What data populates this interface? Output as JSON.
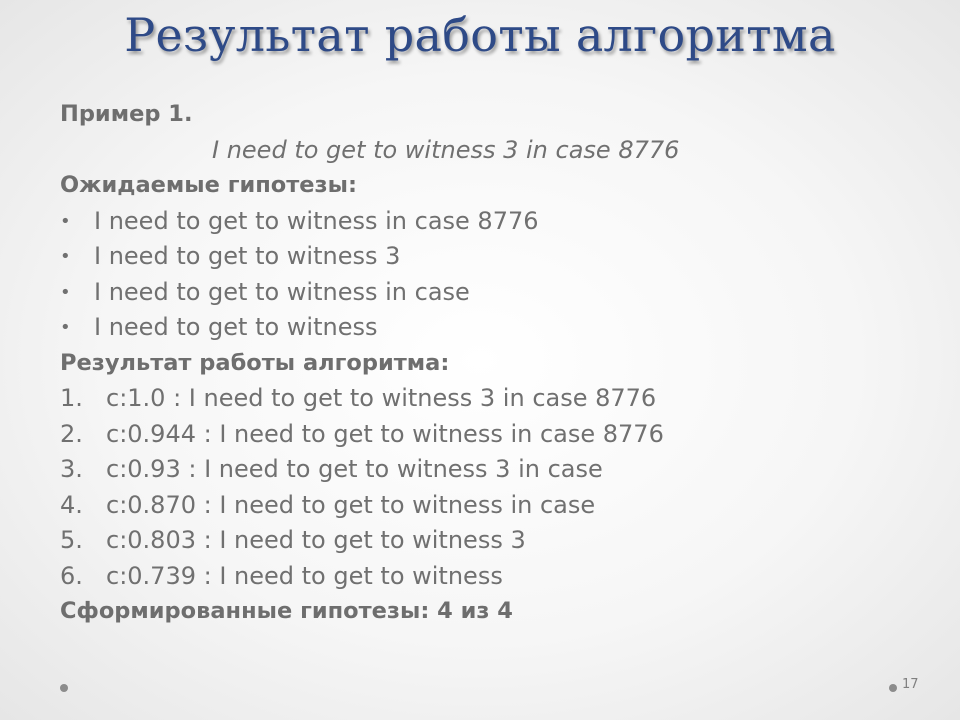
{
  "slide": {
    "title": "Результат работы алгоритма",
    "example_heading": "Пример 1.",
    "example_text": "I need to get to witness 3 in case 8776",
    "expected_heading": "Ожидаемые гипотезы:",
    "expected": [
      "I need to get to witness in case 8776",
      "I need to get to witness 3",
      "I need to get to witness in case",
      "I need to get to witness"
    ],
    "bullet_glyph": "•",
    "result_heading": "Результат работы алгоритма:",
    "results": [
      {
        "num": "1.",
        "text": "c:1.0 : I need to get to witness 3 in case 8776"
      },
      {
        "num": "2.",
        "text": "c:0.944 : I need to get to witness in case 8776"
      },
      {
        "num": "3.",
        "text": "c:0.93 : I need to get to witness 3 in case"
      },
      {
        "num": "4.",
        "text": "c:0.870 : I need to get to witness in case"
      },
      {
        "num": "5.",
        "text": "c:0.803 : I need to get to witness 3"
      },
      {
        "num": "6.",
        "text": "c:0.739 : I need to get to witness"
      }
    ],
    "summary": "Сформированные гипотезы: 4 из 4",
    "page_number": "17"
  },
  "colors": {
    "title": "#2e4a87",
    "body_text": "#707070"
  }
}
